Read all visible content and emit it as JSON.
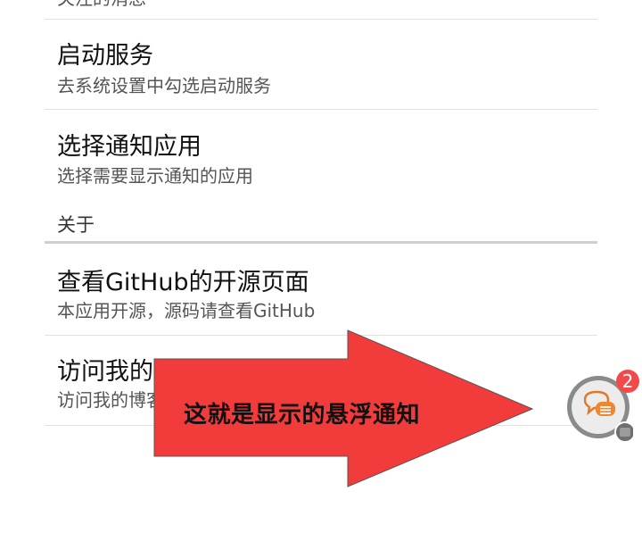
{
  "top_cut_summary": "关注的消息",
  "items": [
    {
      "title": "启动服务",
      "summary": "去系统设置中勾选启动服务"
    },
    {
      "title": "选择通知应用",
      "summary": "选择需要显示通知的应用"
    }
  ],
  "category": {
    "label": "关于"
  },
  "about_items": [
    {
      "title": "查看GitHub的开源页面",
      "summary": "本应用开源，源码请查看GitHub"
    },
    {
      "title": "访问我的博客",
      "summary": "访问我的博客"
    }
  ],
  "annotation": {
    "text": "这就是显示的悬浮通知",
    "color": "#f23c3c"
  },
  "floating_notification": {
    "badge_count": "2",
    "badge_color": "#f24a4a",
    "icon": "chat-bubble-icon"
  }
}
